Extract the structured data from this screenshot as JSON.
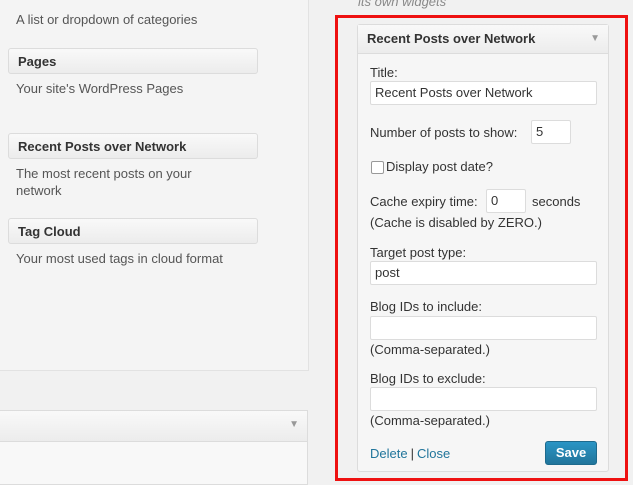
{
  "available_widgets": [
    {
      "title": "",
      "desc": "A list or dropdown of categories"
    },
    {
      "title": "Pages",
      "desc": "Your site's WordPress Pages"
    },
    {
      "title": "Recent Posts over Network",
      "desc": "The most recent posts on your network"
    },
    {
      "title": "Tag Cloud",
      "desc": "Your most used tags in cloud format"
    }
  ],
  "sidebar_intro": "its own widgets",
  "panel": {
    "title": "Recent Posts over Network",
    "title_label": "Title:",
    "title_value": "Recent Posts over Network",
    "num_posts_label": "Number of posts to show:",
    "num_posts_value": "5",
    "display_date_label": "Display post date?",
    "cache_label": "Cache expiry time:",
    "cache_value": "0",
    "cache_unit": "seconds",
    "cache_note": "(Cache is disabled by ZERO.)",
    "post_type_label": "Target post type:",
    "post_type_value": "post",
    "include_label": "Blog IDs to include:",
    "include_value": "",
    "include_note": "(Comma-separated.)",
    "exclude_label": "Blog IDs to exclude:",
    "exclude_value": "",
    "exclude_note": "(Comma-separated.)",
    "delete_label": "Delete",
    "separator": "|",
    "close_label": "Close",
    "save_label": "Save"
  },
  "icons": {
    "collapse": "caret-down-icon",
    "checkbox": "checkbox-icon"
  },
  "colors": {
    "highlight": "#ee1111",
    "link": "#21759b",
    "button": "#21759b"
  }
}
